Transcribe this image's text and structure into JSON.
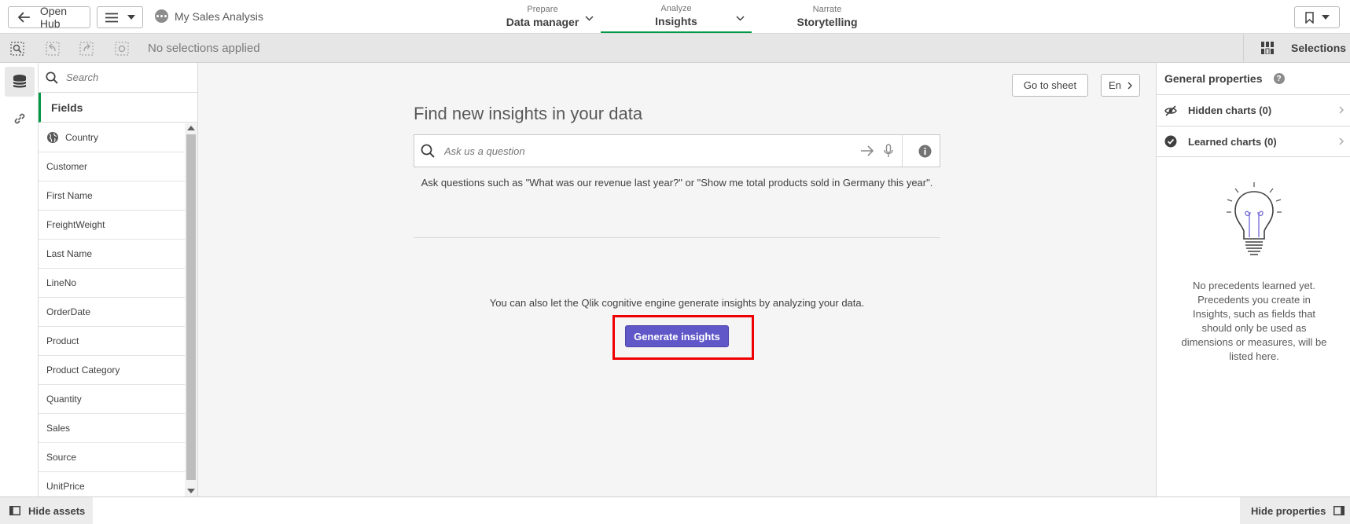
{
  "header": {
    "open_hub_label": "Open Hub",
    "app_title": "My Sales Analysis",
    "tabs": [
      {
        "small": "Prepare",
        "label": "Data manager"
      },
      {
        "small": "Analyze",
        "label": "Insights"
      },
      {
        "small": "Narrate",
        "label": "Storytelling"
      }
    ],
    "active_tab": "Insights"
  },
  "selections_bar": {
    "status": "No selections applied",
    "selections_label": "Selections"
  },
  "assets": {
    "search_placeholder": "Search",
    "section_title": "Fields",
    "fields": [
      "Country",
      "Customer",
      "First Name",
      "FreightWeight",
      "Last Name",
      "LineNo",
      "OrderDate",
      "Product",
      "Product Category",
      "Quantity",
      "Sales",
      "Source",
      "UnitPrice"
    ]
  },
  "insights": {
    "go_to_sheet_label": "Go to sheet",
    "language_label": "En",
    "title": "Find new insights in your data",
    "ask_placeholder": "Ask us a question",
    "examples_text": "Ask questions such as \"What was our revenue last year?\" or \"Show me total products sold in Germany this year\".",
    "generate_text": "You can also let the Qlik cognitive engine generate insights by analyzing your data.",
    "generate_button": "Generate insights"
  },
  "properties": {
    "title": "General properties",
    "hidden_charts": "Hidden charts (0)",
    "learned_charts": "Learned charts (0)",
    "empty_message": "No precedents learned yet. Precedents you create in Insights, such as fields that should only be used as dimensions or measures, will be listed here."
  },
  "footer": {
    "hide_assets": "Hide assets",
    "hide_properties": "Hide properties"
  },
  "colors": {
    "accent_green": "#009845",
    "primary_button": "#6058c8",
    "highlight_frame": "#ee0000"
  }
}
